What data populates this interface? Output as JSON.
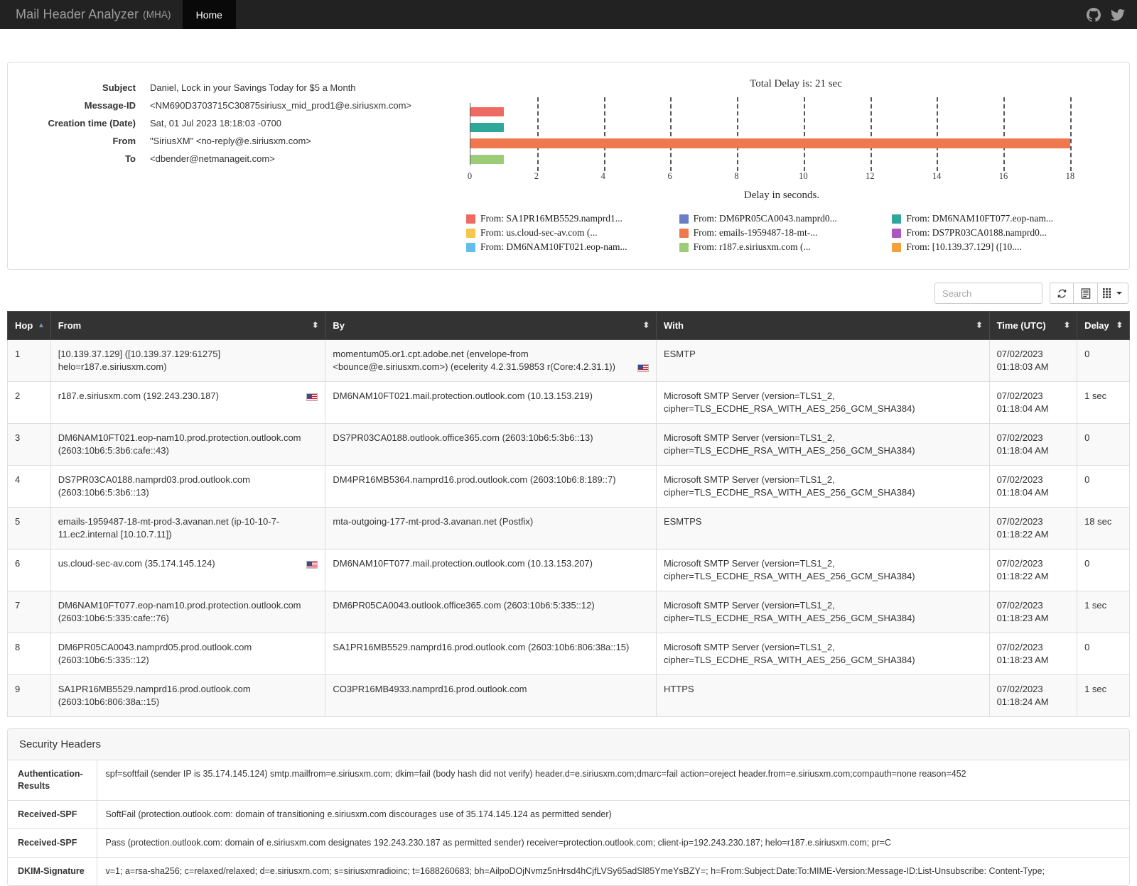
{
  "navbar": {
    "brand": "Mail Header Analyzer",
    "brand_suffix": "(MHA)",
    "tab_home": "Home",
    "github_icon": "github-icon",
    "twitter_icon": "twitter-icon"
  },
  "email": {
    "rows": [
      {
        "label": "Subject",
        "value": "Daniel, Lock in your Savings Today for $5 a Month"
      },
      {
        "label": "Message-ID",
        "value": "<NM690D3703715C30875siriusx_mid_prod1@e.siriusxm.com>"
      },
      {
        "label": "Creation time (Date)",
        "value": "Sat, 01 Jul 2023 18:18:03 -0700"
      },
      {
        "label": "From",
        "value": "\"SiriusXM\" <no-reply@e.siriusxm.com>"
      },
      {
        "label": "To",
        "value": "<dbender@netmanageit.com>"
      }
    ]
  },
  "chart_data": {
    "type": "bar",
    "orientation": "horizontal",
    "title": "Total Delay is: 21 sec",
    "xlabel": "Delay in seconds.",
    "ylabel": "",
    "xlim": [
      0,
      18.6
    ],
    "xticks": [
      0,
      2,
      4,
      6,
      8,
      10,
      12,
      14,
      16,
      18
    ],
    "grid": true,
    "legend_position": "bottom",
    "categories": [
      "From: SA1PR16MB5529.namprd1...",
      "From: DM6PR05CA0043.namprd0...",
      "From: DM6NAM10FT077.eop-nam...",
      "From: us.cloud-sec-av.com (...",
      "From: emails-1959487-18-mt-...",
      "From: DS7PR03CA0188.namprd0...",
      "From: DM6NAM10FT021.eop-nam...",
      "From: r187.e.siriusxm.com (...",
      "From: [10.139.37.129] ([10...."
    ],
    "values": [
      1,
      0,
      1,
      0,
      18,
      0,
      0,
      1,
      0
    ],
    "colors": [
      "#ef6a62",
      "#6b7ec4",
      "#2fa79b",
      "#f5c54e",
      "#f0784e",
      "#ae55c0",
      "#63bdea",
      "#9ccc78",
      "#f2a13e"
    ],
    "bars": [
      {
        "name": "SA1PR16MB5529",
        "value": 1,
        "color": "#ef6a62",
        "row": 0
      },
      {
        "name": "DM6NAM10FT077",
        "value": 1,
        "color": "#2fa79b",
        "row": 1
      },
      {
        "name": "emails-1959487-18-mt",
        "value": 18,
        "color": "#f0784e",
        "row": 2
      },
      {
        "name": "r187.e.siriusxm.com",
        "value": 1,
        "color": "#9ccc78",
        "row": 3
      }
    ],
    "legend": [
      {
        "label": "From: SA1PR16MB5529.namprd1...",
        "color": "#ef6a62"
      },
      {
        "label": "From: DM6PR05CA0043.namprd0...",
        "color": "#6b7ec4"
      },
      {
        "label": "From: DM6NAM10FT077.eop-nam...",
        "color": "#2fa79b"
      },
      {
        "label": "From: us.cloud-sec-av.com (...",
        "color": "#f5c54e"
      },
      {
        "label": "From: emails-1959487-18-mt-...",
        "color": "#f0784e"
      },
      {
        "label": "From: DS7PR03CA0188.namprd0...",
        "color": "#ae55c0"
      },
      {
        "label": "From: DM6NAM10FT021.eop-nam...",
        "color": "#63bdea"
      },
      {
        "label": "From: r187.e.siriusxm.com (...",
        "color": "#9ccc78"
      },
      {
        "label": "From: [10.139.37.129] ([10....",
        "color": "#f2a13e"
      }
    ]
  },
  "toolbar": {
    "search_placeholder": "Search",
    "search_value": "",
    "refresh_icon": "refresh-icon",
    "columns_icon": "list-view-icon",
    "grid_icon": "grid-view-icon"
  },
  "table": {
    "columns": [
      {
        "key": "hop",
        "label": "Hop"
      },
      {
        "key": "from",
        "label": "From"
      },
      {
        "key": "by",
        "label": "By"
      },
      {
        "key": "with",
        "label": "With"
      },
      {
        "key": "time",
        "label": "Time (UTC)"
      },
      {
        "key": "delay",
        "label": "Delay"
      }
    ],
    "rows": [
      {
        "hop": "1",
        "from": "[10.139.37.129] ([10.139.37.129:61275] helo=r187.e.siriusxm.com)",
        "from_flag": false,
        "by": "momentum05.or1.cpt.adobe.net (envelope-from <bounce@e.siriusxm.com>) (ecelerity 4.2.31.59853 r(Core:4.2.31.1))",
        "by_flag": true,
        "with": "ESMTP",
        "time": "07/02/2023 01:18:03 AM",
        "delay": "0"
      },
      {
        "hop": "2",
        "from": "r187.e.siriusxm.com (192.243.230.187)",
        "from_flag": true,
        "by": "DM6NAM10FT021.mail.protection.outlook.com (10.13.153.219)",
        "by_flag": false,
        "with": "Microsoft SMTP Server (version=TLS1_2, cipher=TLS_ECDHE_RSA_WITH_AES_256_GCM_SHA384)",
        "time": "07/02/2023 01:18:04 AM",
        "delay": "1 sec"
      },
      {
        "hop": "3",
        "from": "DM6NAM10FT021.eop-nam10.prod.protection.outlook.com (2603:10b6:5:3b6:cafe::43)",
        "from_flag": false,
        "by": "DS7PR03CA0188.outlook.office365.com (2603:10b6:5:3b6::13)",
        "by_flag": false,
        "with": "Microsoft SMTP Server (version=TLS1_2, cipher=TLS_ECDHE_RSA_WITH_AES_256_GCM_SHA384)",
        "time": "07/02/2023 01:18:04 AM",
        "delay": "0"
      },
      {
        "hop": "4",
        "from": "DS7PR03CA0188.namprd03.prod.outlook.com (2603:10b6:5:3b6::13)",
        "from_flag": false,
        "by": "DM4PR16MB5364.namprd16.prod.outlook.com (2603:10b6:8:189::7)",
        "by_flag": false,
        "with": "Microsoft SMTP Server (version=TLS1_2, cipher=TLS_ECDHE_RSA_WITH_AES_256_GCM_SHA384)",
        "time": "07/02/2023 01:18:04 AM",
        "delay": "0"
      },
      {
        "hop": "5",
        "from": "emails-1959487-18-mt-prod-3.avanan.net (ip-10-10-7-11.ec2.internal [10.10.7.11])",
        "from_flag": false,
        "by": "mta-outgoing-177-mt-prod-3.avanan.net (Postfix)",
        "by_flag": false,
        "with": "ESMTPS",
        "time": "07/02/2023 01:18:22 AM",
        "delay": "18 sec"
      },
      {
        "hop": "6",
        "from": "us.cloud-sec-av.com (35.174.145.124)",
        "from_flag": true,
        "by": "DM6NAM10FT077.mail.protection.outlook.com (10.13.153.207)",
        "by_flag": false,
        "with": "Microsoft SMTP Server (version=TLS1_2, cipher=TLS_ECDHE_RSA_WITH_AES_256_GCM_SHA384)",
        "time": "07/02/2023 01:18:22 AM",
        "delay": "0"
      },
      {
        "hop": "7",
        "from": "DM6NAM10FT077.eop-nam10.prod.protection.outlook.com (2603:10b6:5:335:cafe::76)",
        "from_flag": false,
        "by": "DM6PR05CA0043.outlook.office365.com (2603:10b6:5:335::12)",
        "by_flag": false,
        "with": "Microsoft SMTP Server (version=TLS1_2, cipher=TLS_ECDHE_RSA_WITH_AES_256_GCM_SHA384)",
        "time": "07/02/2023 01:18:23 AM",
        "delay": "1 sec"
      },
      {
        "hop": "8",
        "from": "DM6PR05CA0043.namprd05.prod.outlook.com (2603:10b6:5:335::12)",
        "from_flag": false,
        "by": "SA1PR16MB5529.namprd16.prod.outlook.com (2603:10b6:806:38a::15)",
        "by_flag": false,
        "with": "Microsoft SMTP Server (version=TLS1_2, cipher=TLS_ECDHE_RSA_WITH_AES_256_GCM_SHA384)",
        "time": "07/02/2023 01:18:23 AM",
        "delay": "0"
      },
      {
        "hop": "9",
        "from": "SA1PR16MB5529.namprd16.prod.outlook.com (2603:10b6:806:38a::15)",
        "from_flag": false,
        "by": "CO3PR16MB4933.namprd16.prod.outlook.com",
        "by_flag": false,
        "with": "HTTPS",
        "time": "07/02/2023 01:18:24 AM",
        "delay": "1 sec"
      }
    ]
  },
  "security": {
    "title": "Security Headers",
    "rows": [
      {
        "name": "Authentication-Results",
        "value": "spf=softfail (sender IP is 35.174.145.124) smtp.mailfrom=e.siriusxm.com; dkim=fail (body hash did not verify) header.d=e.siriusxm.com;dmarc=fail action=oreject header.from=e.siriusxm.com;compauth=none reason=452"
      },
      {
        "name": "Received-SPF",
        "value": "SoftFail (protection.outlook.com: domain of transitioning e.siriusxm.com discourages use of 35.174.145.124 as permitted sender)"
      },
      {
        "name": "Received-SPF",
        "value": "Pass (protection.outlook.com: domain of e.siriusxm.com designates 192.243.230.187 as permitted sender) receiver=protection.outlook.com; client-ip=192.243.230.187; helo=r187.e.siriusxm.com; pr=C"
      },
      {
        "name": "DKIM-Signature",
        "value": "v=1; a=rsa-sha256; c=relaxed/relaxed; d=e.siriusxm.com; s=siriusxmradioinc; t=1688260683; bh=AilpoDOjNvmz5nHrsd4hCjfLVSy65adSl85YmeYsBZY=; h=From:Subject:Date:To:MIME-Version:Message-ID:List-Unsubscribe: Content-Type;"
      }
    ]
  }
}
